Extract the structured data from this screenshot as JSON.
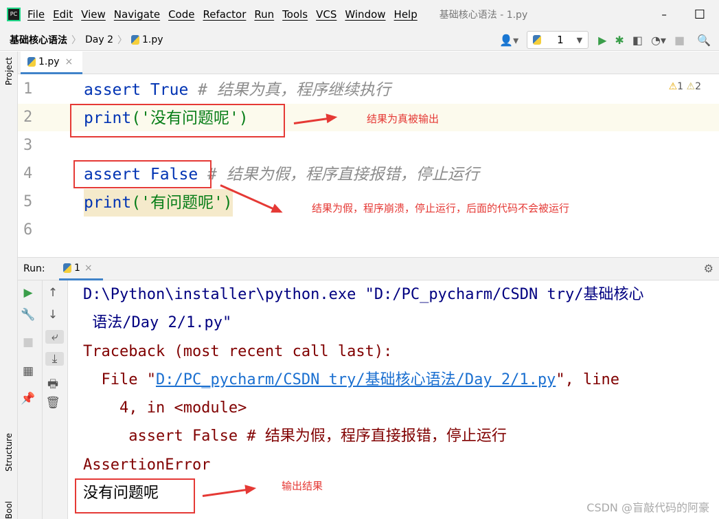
{
  "menubar": {
    "items": [
      "File",
      "Edit",
      "View",
      "Navigate",
      "Code",
      "Refactor",
      "Run",
      "Tools",
      "VCS",
      "Window",
      "Help"
    ],
    "title": "基础核心语法 - 1.py",
    "minimize": "–",
    "maximize": "☐"
  },
  "breadcrumb": [
    "基础核心语法",
    "Day 2",
    "1.py"
  ],
  "toolbar": {
    "run_config": "1"
  },
  "left_strip": {
    "project": "Project",
    "structure": "Structure",
    "bookmarks": "Bookmarks"
  },
  "editor": {
    "tab": "1.py",
    "warnings": "1",
    "weak_warnings": "2",
    "lines": [
      {
        "n": "1",
        "kw": "assert True",
        "rest": "",
        "comment": " # 结果为真，程序继续执行"
      },
      {
        "n": "2",
        "kw": "print",
        "rest": "('没有问题呢')",
        "comment": ""
      },
      {
        "n": "3",
        "kw": "",
        "rest": "",
        "comment": ""
      },
      {
        "n": "4",
        "kw": "assert False",
        "rest": "",
        "comment": " # 结果为假，程序直接报错，停止运行"
      },
      {
        "n": "5",
        "kw": "print",
        "rest": "('有问题呢')",
        "comment": ""
      },
      {
        "n": "6",
        "kw": "",
        "rest": "",
        "comment": ""
      }
    ],
    "annotations": [
      "结果为真被输出",
      "结果为假，程序崩溃，停止运行，后面的代码不会被运行"
    ]
  },
  "run": {
    "label": "Run:",
    "tab": "1",
    "output": {
      "cmd1": "D:\\Python\\installer\\python.exe \"D:/PC_pycharm/CSDN try/基础核心",
      "cmd2": " 语法/Day 2/1.py\"",
      "tb": "Traceback (most recent call last):",
      "file_pre": "  File \"",
      "file_link": "D:/PC_pycharm/CSDN try/基础核心语法/Day 2/1.py",
      "file_post": "\", line",
      "line4": "    4, in <module>",
      "src": "     assert False # 结果为假，程序直接报错，停止运行",
      "err": "AssertionError",
      "out": "没有问题呢"
    },
    "annotation": "输出结果"
  },
  "watermark": "CSDN @盲敲代码的阿豪",
  "colors": {
    "keyword": "#0033b3",
    "string": "#067d17",
    "error": "#800000",
    "annotation": "#e53935"
  }
}
